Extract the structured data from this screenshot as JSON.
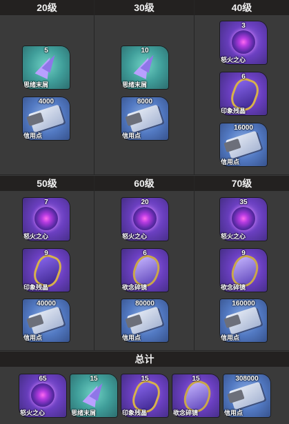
{
  "levels": [
    {
      "label": "20级",
      "items": [
        {
          "name": "思绪末屑",
          "qty": "5"
        },
        {
          "name": "信用点",
          "qty": "4000"
        }
      ]
    },
    {
      "label": "30级",
      "items": [
        {
          "name": "思绪末屑",
          "qty": "10"
        },
        {
          "name": "信用点",
          "qty": "8000"
        }
      ]
    },
    {
      "label": "40级",
      "items": [
        {
          "name": "怒火之心",
          "qty": "3"
        },
        {
          "name": "印象残晶",
          "qty": "6"
        },
        {
          "name": "信用点",
          "qty": "16000"
        }
      ]
    },
    {
      "label": "50级",
      "items": [
        {
          "name": "怒火之心",
          "qty": "7"
        },
        {
          "name": "印象残晶",
          "qty": "9"
        },
        {
          "name": "信用点",
          "qty": "40000"
        }
      ]
    },
    {
      "label": "60级",
      "items": [
        {
          "name": "怒火之心",
          "qty": "20"
        },
        {
          "name": "欲念碎镜",
          "qty": "6"
        },
        {
          "name": "信用点",
          "qty": "80000"
        }
      ]
    },
    {
      "label": "70级",
      "items": [
        {
          "name": "怒火之心",
          "qty": "35"
        },
        {
          "name": "欲念碎镜",
          "qty": "9"
        },
        {
          "name": "信用点",
          "qty": "160000"
        }
      ]
    }
  ],
  "total": {
    "label": "总计",
    "items": [
      {
        "name": "怒火之心",
        "qty": "65"
      },
      {
        "name": "思绪末屑",
        "qty": "15"
      },
      {
        "name": "印象残晶",
        "qty": "15"
      },
      {
        "name": "欲念碎镜",
        "qty": "15"
      },
      {
        "name": "信用点",
        "qty": "308000"
      }
    ]
  }
}
